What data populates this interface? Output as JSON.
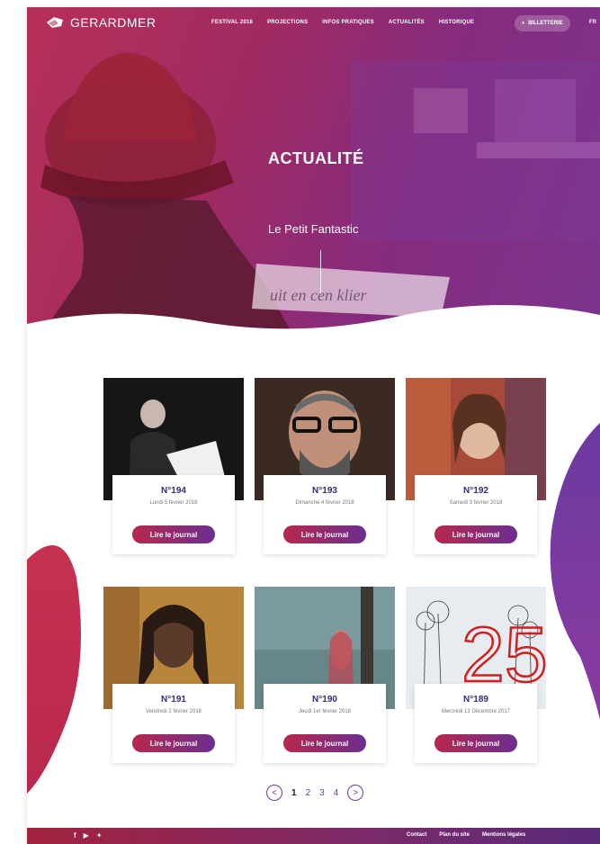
{
  "header": {
    "logo_text": "GERARDMER",
    "menu": [
      "FESTIVAL 2018",
      "PROJECTIONS",
      "INFOS PRATIQUES",
      "ACTUALITÉS",
      "HISTORIQUE"
    ],
    "ticket_label": "BILLETTERIE",
    "lang": "FR"
  },
  "hero": {
    "title": "ACTUALITÉ",
    "subtitle": "Le Petit Fantastic",
    "newspaper_text": "uit en cen klier"
  },
  "cards": [
    {
      "number": "N°194",
      "date": "Lundi 5 février 2018",
      "button": "Lire le journal",
      "icon": "podium-speaker-photo"
    },
    {
      "number": "N°193",
      "date": "Dimanche 4 février 2018",
      "button": "Lire le journal",
      "icon": "bearded-man-photo"
    },
    {
      "number": "N°192",
      "date": "Samedi 3 février 2018",
      "button": "Lire le journal",
      "icon": "smiling-woman-photo"
    },
    {
      "number": "N°191",
      "date": "Vendredi 2 février 2018",
      "button": "Lire le journal",
      "icon": "woman-braids-photo"
    },
    {
      "number": "N°190",
      "date": "Jeudi 1er février 2018",
      "button": "Lire le journal",
      "icon": "pole-figure-photo"
    },
    {
      "number": "N°189",
      "date": "Mercredi 13 Décembre 2017",
      "button": "Lire le journal",
      "icon": "25-dandelion-poster",
      "poster_text": "25"
    }
  ],
  "pagination": {
    "prev": "<",
    "pages": [
      "1",
      "2",
      "3",
      "4"
    ],
    "current": "1",
    "next": ">"
  },
  "footer": {
    "social": [
      "facebook-icon",
      "youtube-icon",
      "twitter-icon"
    ],
    "links": [
      "Contact",
      "Plan du site",
      "Mentions légales"
    ]
  },
  "colors": {
    "brand_red": "#b8284e",
    "brand_purple": "#6b2f8f",
    "number_text": "#3a2a7a"
  }
}
